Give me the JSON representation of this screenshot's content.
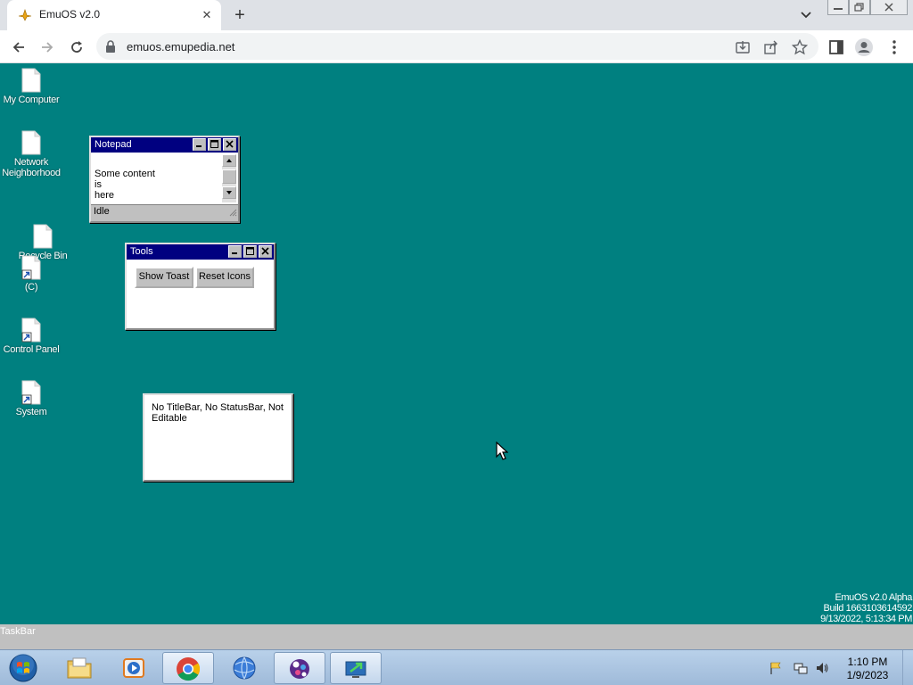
{
  "browser": {
    "tab_title": "EmuOS v2.0",
    "tab_close": "✕",
    "new_tab": "+",
    "url": "emuos.emupedia.net"
  },
  "desktop": {
    "background": "#008080",
    "icons": [
      {
        "label": "My Computer",
        "shortcut": false
      },
      {
        "label": "Network Neighborhood",
        "shortcut": false
      },
      {
        "label": "Recycle Bin",
        "shortcut": false
      },
      {
        "label": "(C)",
        "shortcut": true
      },
      {
        "label": "Control Panel",
        "shortcut": true
      },
      {
        "label": "System",
        "shortcut": true
      }
    ],
    "version_lines": [
      "EmuOS v2.0 Alpha",
      "Build 1663103614592",
      "9/13/2022, 5:13:34 PM"
    ]
  },
  "notepad": {
    "title": "Notepad",
    "content_lines": [
      "Some content",
      "is",
      "here"
    ],
    "status": "Idle"
  },
  "tools": {
    "title": "Tools",
    "show_toast_label": "Show Toast",
    "reset_icons_label": "Reset Icons"
  },
  "notitle_window": {
    "text": "No TitleBar, No StatusBar, Not Editable"
  },
  "emu_taskbar": {
    "label": "TaskBar"
  },
  "os_taskbar": {
    "apps": [
      "file-explorer",
      "media-player",
      "chrome",
      "internet-explorer",
      "app-launcher",
      "remote-desktop"
    ],
    "clock_time": "1:10 PM",
    "clock_date": "1/9/2023"
  }
}
